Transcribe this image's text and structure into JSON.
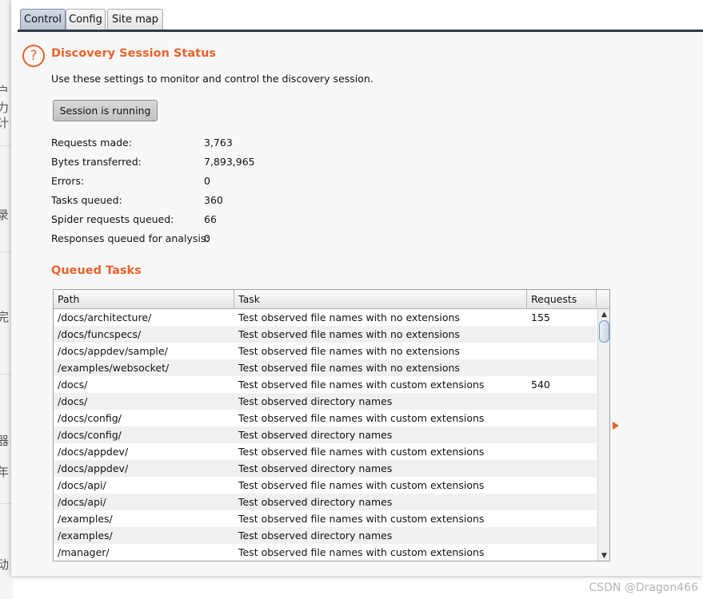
{
  "background_glyphs": [
    "户力",
    "计",
    "录",
    "完",
    "器",
    "年",
    "动"
  ],
  "tabs": [
    {
      "label": "Control",
      "active": true
    },
    {
      "label": "Config",
      "active": false
    },
    {
      "label": "Site map",
      "active": false
    }
  ],
  "help_icon": "?",
  "status": {
    "title": "Discovery Session Status",
    "description": "Use these settings to monitor and control the discovery session.",
    "session_button": "Session is running"
  },
  "stats": [
    {
      "label": "Requests made:",
      "value": "3,763"
    },
    {
      "label": "Bytes transferred:",
      "value": "7,893,965"
    },
    {
      "label": "Errors:",
      "value": "0"
    },
    {
      "label": "Tasks queued:",
      "value": "360"
    },
    {
      "label": "Spider requests queued:",
      "value": "66"
    },
    {
      "label": "Responses queued for analysis:",
      "value": "0"
    }
  ],
  "queued_tasks": {
    "title": "Queued Tasks",
    "columns": [
      "Path",
      "Task",
      "Requests"
    ],
    "rows": [
      {
        "path": "/docs/architecture/",
        "task": "Test observed file names with no extensions",
        "requests": "155"
      },
      {
        "path": "/docs/funcspecs/",
        "task": "Test observed file names with no extensions",
        "requests": ""
      },
      {
        "path": "/docs/appdev/sample/",
        "task": "Test observed file names with no extensions",
        "requests": ""
      },
      {
        "path": "/examples/websocket/",
        "task": "Test observed file names with no extensions",
        "requests": ""
      },
      {
        "path": "/docs/",
        "task": "Test observed file names with custom extensions",
        "requests": "540"
      },
      {
        "path": "/docs/",
        "task": "Test observed directory names",
        "requests": ""
      },
      {
        "path": "/docs/config/",
        "task": "Test observed file names with custom extensions",
        "requests": ""
      },
      {
        "path": "/docs/config/",
        "task": "Test observed directory names",
        "requests": ""
      },
      {
        "path": "/docs/appdev/",
        "task": "Test observed file names with custom extensions",
        "requests": ""
      },
      {
        "path": "/docs/appdev/",
        "task": "Test observed directory names",
        "requests": ""
      },
      {
        "path": "/docs/api/",
        "task": "Test observed file names with custom extensions",
        "requests": ""
      },
      {
        "path": "/docs/api/",
        "task": "Test observed directory names",
        "requests": ""
      },
      {
        "path": "/examples/",
        "task": "Test observed file names with custom extensions",
        "requests": ""
      },
      {
        "path": "/examples/",
        "task": "Test observed directory names",
        "requests": ""
      },
      {
        "path": "/manager/",
        "task": "Test observed file names with custom extensions",
        "requests": ""
      }
    ]
  },
  "scroll": {
    "up": "▲",
    "down": "▼"
  },
  "watermark": "CSDN @Dragon466",
  "colors": {
    "accent": "#e8632d",
    "tab_active": "#b7c4d2",
    "tabbar_line": "#2e3b4a"
  }
}
